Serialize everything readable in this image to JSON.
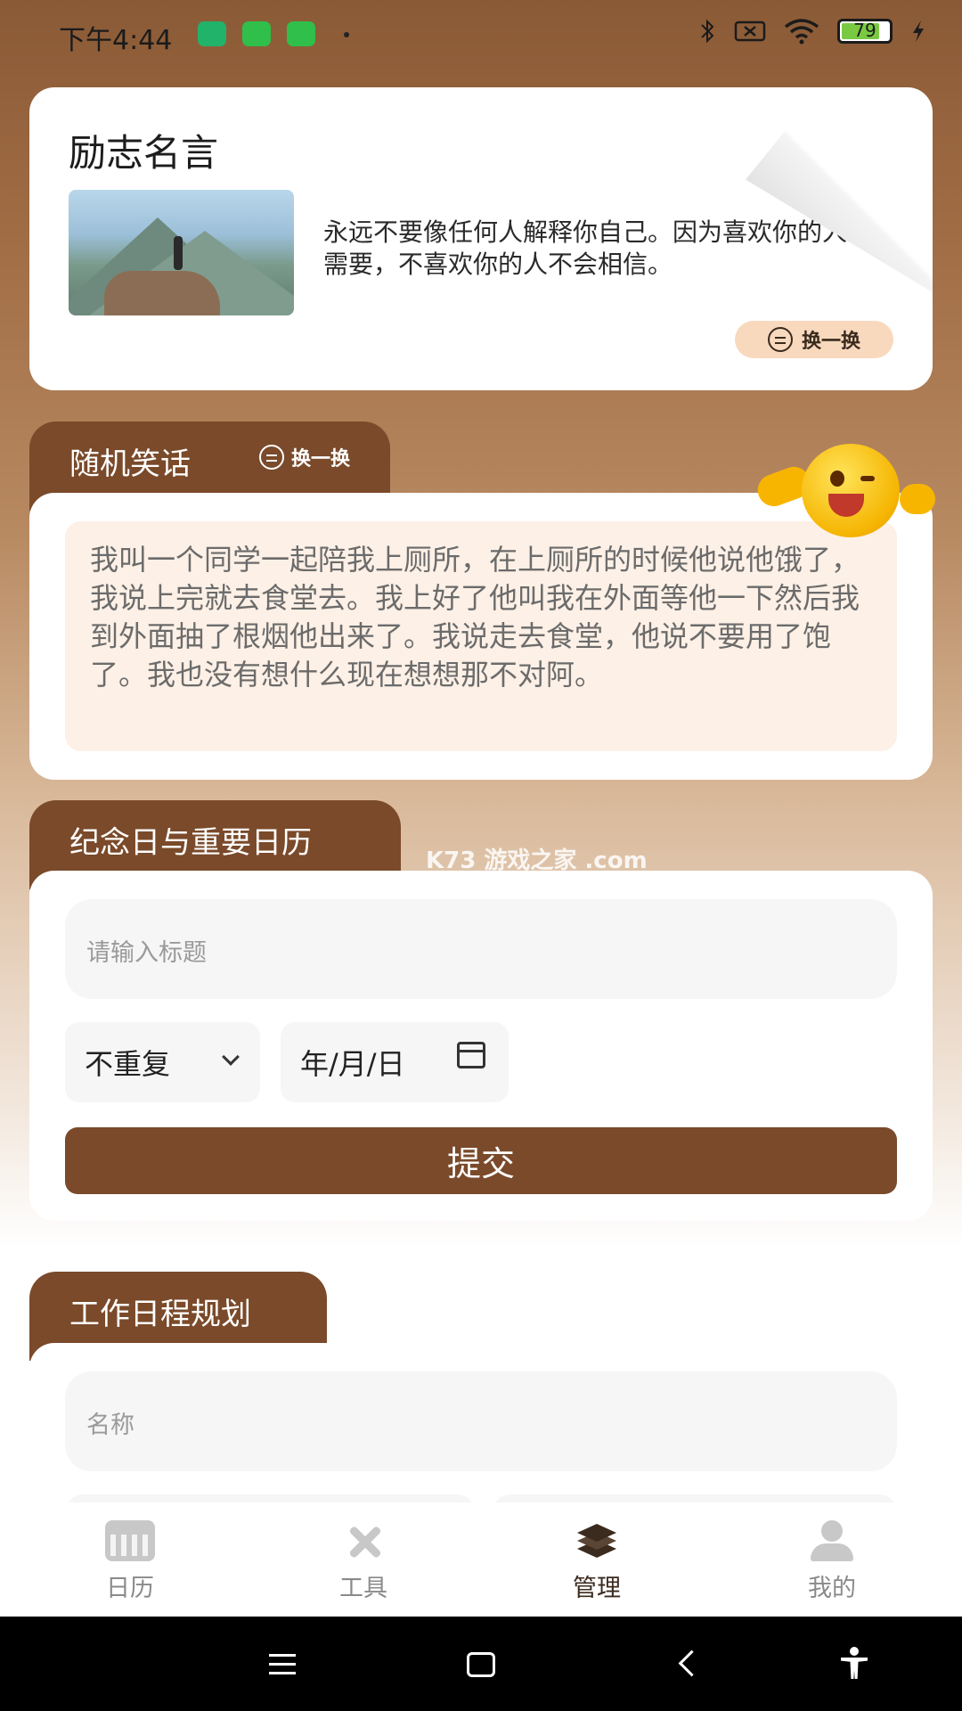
{
  "status_bar": {
    "time": "下午4:44",
    "battery": "79"
  },
  "quote": {
    "title": "励志名言",
    "text": "永远不要像任何人解释你自己。因为喜欢你的人不需要，不喜欢你的人不会相信。",
    "swap_label": "换一换"
  },
  "joke": {
    "title": "随机笑话",
    "swap_label": "换一换",
    "text": "我叫一个同学一起陪我上厕所，在上厕所的时候他说他饿了，我说上完就去食堂去。我上好了他叫我在外面等他一下然后我到外面抽了根烟他出来了。我说走去食堂，他说不要用了饱了。我也没有想什么现在想想那不对阿。"
  },
  "anniversary": {
    "title": "纪念日与重要日历",
    "title_placeholder": "请输入标题",
    "repeat_value": "不重复",
    "date_value": "年/月/日",
    "submit_label": "提交"
  },
  "watermark": "K73 游戏之家 .com",
  "schedule": {
    "title": "工作日程规划",
    "name_placeholder": "名称"
  },
  "tabbar": {
    "items": [
      {
        "label": "日历",
        "icon": "calendar-icon"
      },
      {
        "label": "工具",
        "icon": "tools-icon"
      },
      {
        "label": "管理",
        "icon": "layers-icon",
        "active": true
      },
      {
        "label": "我的",
        "icon": "user-icon"
      }
    ]
  }
}
